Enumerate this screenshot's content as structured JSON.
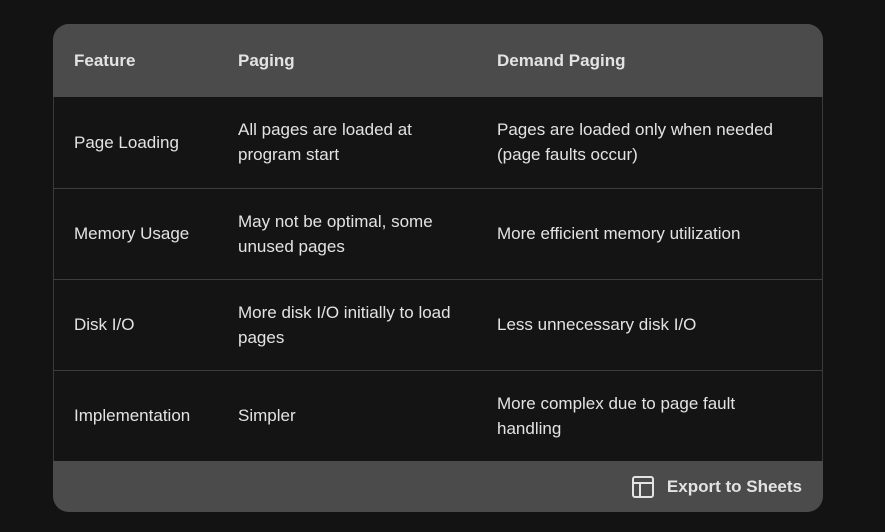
{
  "table": {
    "headers": [
      "Feature",
      "Paging",
      "Demand Paging"
    ],
    "rows": [
      [
        "Page Loading",
        "All pages are loaded at program start",
        "Pages are loaded only when needed (page faults occur)"
      ],
      [
        "Memory Usage",
        "May not be optimal, some unused pages",
        "More efficient memory utilization"
      ],
      [
        "Disk I/O",
        "More disk I/O initially to load pages",
        "Less unnecessary disk I/O"
      ],
      [
        "Implementation",
        "Simpler",
        "More complex due to page fault handling"
      ]
    ]
  },
  "footer": {
    "export_label": "Export to Sheets",
    "export_icon": "table-grid-icon"
  },
  "colors": {
    "page_bg": "#131313",
    "header_bg": "#4a4b4a",
    "body_bg": "#141414",
    "text": "#e3e3e3"
  }
}
